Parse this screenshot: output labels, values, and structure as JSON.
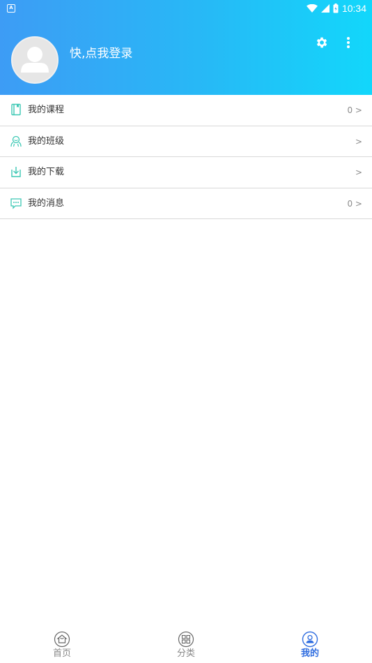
{
  "status_bar": {
    "time": "10:34",
    "app_badge": "A"
  },
  "header": {
    "login_prompt": "快,点我登录",
    "icons": [
      "settings-gear-icon",
      "more-vertical-icon"
    ]
  },
  "menu": {
    "items": [
      {
        "icon": "book-icon",
        "label": "我的课程",
        "trail": "0 >"
      },
      {
        "icon": "class-group-icon",
        "label": "我的班级",
        "trail": ">"
      },
      {
        "icon": "download-icon",
        "label": "我的下载",
        "trail": ">"
      },
      {
        "icon": "message-icon",
        "label": "我的消息",
        "trail": "0 >"
      }
    ]
  },
  "bottom_nav": {
    "tabs": [
      {
        "icon": "home-icon",
        "label": "首页",
        "active": false
      },
      {
        "icon": "category-icon",
        "label": "分类",
        "active": false
      },
      {
        "icon": "profile-icon",
        "label": "我的",
        "active": true
      }
    ]
  },
  "colors": {
    "header_gradient_start": "#3d9cf5",
    "header_gradient_end": "#12d7fb",
    "menu_icon_accent": "#3cc8b4",
    "active_tab": "#2f6de0",
    "inactive_tab": "#888888"
  }
}
